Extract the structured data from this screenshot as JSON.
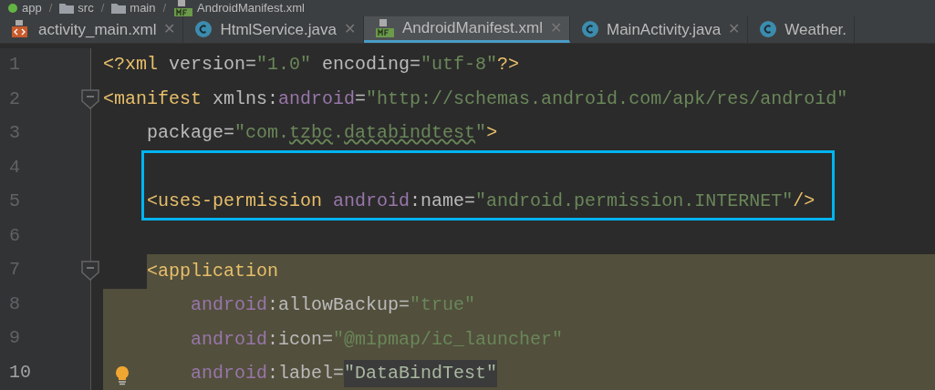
{
  "breadcrumb": [
    {
      "kind": "module",
      "label": "app"
    },
    {
      "kind": "separator",
      "label": "/"
    },
    {
      "kind": "folder",
      "label": "src"
    },
    {
      "kind": "separator",
      "label": "/"
    },
    {
      "kind": "folder",
      "label": "main"
    },
    {
      "kind": "separator",
      "label": "/"
    },
    {
      "kind": "manifest",
      "label": "AndroidManifest.xml"
    }
  ],
  "tabs": [
    {
      "kind": "xml",
      "label": "activity_main.xml",
      "selected": false,
      "close": "✕"
    },
    {
      "kind": "class",
      "label": "HtmlService.java",
      "selected": false,
      "close": "✕"
    },
    {
      "kind": "manifest",
      "label": "AndroidManifest.xml",
      "selected": true,
      "close": "✕"
    },
    {
      "kind": "class",
      "label": "MainActivity.java",
      "selected": false,
      "close": "✕"
    },
    {
      "kind": "class",
      "label": "Weather.",
      "selected": false
    }
  ],
  "lines": [
    {
      "number": "1",
      "fold": false,
      "current": false,
      "boxed": false,
      "highlighted": false,
      "hint": false,
      "tokens": [
        {
          "kind": "tag",
          "text": "<?xml "
        },
        {
          "kind": "attr",
          "text": "version="
        },
        {
          "kind": "value",
          "text": "\"1.0\""
        },
        {
          "kind": "attr",
          "text": " encoding="
        },
        {
          "kind": "value",
          "text": "\"utf-8\""
        },
        {
          "kind": "tag",
          "text": "?>"
        }
      ]
    },
    {
      "number": "2",
      "fold": true,
      "current": false,
      "boxed": false,
      "highlighted": false,
      "hint": false,
      "tokens": [
        {
          "kind": "tag",
          "text": "<manifest "
        },
        {
          "kind": "attr",
          "text": "xmlns:"
        },
        {
          "kind": "ns",
          "text": "android"
        },
        {
          "kind": "attr",
          "text": "="
        },
        {
          "kind": "value",
          "text": "\"http://schemas.android.com/apk/res/android\""
        }
      ],
      "children": [
        {
          "number": "3",
          "fold": false,
          "current": false,
          "boxed": false,
          "highlighted": false,
          "hint": false,
          "tokens": [
            {
              "kind": "attr",
              "text": "package="
            },
            {
              "kind": "value",
              "text": "\"com."
            },
            {
              "kind": "typo",
              "text": "tzbc"
            },
            {
              "kind": "value",
              "text": "."
            },
            {
              "kind": "typo",
              "text": "databindtest"
            },
            {
              "kind": "value",
              "text": "\""
            },
            {
              "kind": "tag",
              "text": ">"
            }
          ]
        },
        {
          "number": "4",
          "fold": false,
          "current": false,
          "boxed": true,
          "highlighted": false,
          "hint": false
        },
        {
          "number": "5",
          "fold": false,
          "current": false,
          "boxed": true,
          "highlighted": false,
          "hint": false,
          "tokens": [
            {
              "kind": "tag",
              "text": "<uses-permission "
            },
            {
              "kind": "ns",
              "text": "android"
            },
            {
              "kind": "attr",
              "text": ":name="
            },
            {
              "kind": "value",
              "text": "\"android.permission.INTERNET\""
            },
            {
              "kind": "tag",
              "text": "/>"
            }
          ]
        },
        {
          "number": "6",
          "fold": false,
          "current": false,
          "boxed": false,
          "highlighted": false,
          "hint": false
        },
        {
          "number": "7",
          "fold": true,
          "current": false,
          "boxed": false,
          "highlighted": true,
          "hint": false,
          "tokens": [
            {
              "kind": "tag",
              "text": "<application"
            }
          ],
          "children": [
            {
              "number": "8",
              "fold": false,
              "current": false,
              "boxed": false,
              "highlighted": true,
              "hint": false,
              "tokens": [
                {
                  "kind": "ns",
                  "text": "android"
                },
                {
                  "kind": "attr",
                  "text": ":allowBackup="
                },
                {
                  "kind": "value",
                  "text": "\"true\""
                }
              ]
            },
            {
              "number": "9",
              "fold": false,
              "current": false,
              "boxed": false,
              "highlighted": true,
              "hint": false,
              "tokens": [
                {
                  "kind": "ns",
                  "text": "android"
                },
                {
                  "kind": "attr",
                  "text": ":icon="
                },
                {
                  "kind": "value",
                  "text": "\"@mipmap/ic_launcher\""
                }
              ]
            },
            {
              "number": "10",
              "fold": false,
              "current": true,
              "boxed": false,
              "highlighted": true,
              "hint": true,
              "tokens": [
                {
                  "kind": "ns",
                  "text": "android"
                },
                {
                  "kind": "attr",
                  "text": ":label="
                },
                {
                  "kind": "marked",
                  "text": "\"DataBindTest\""
                }
              ]
            }
          ]
        }
      ]
    }
  ]
}
